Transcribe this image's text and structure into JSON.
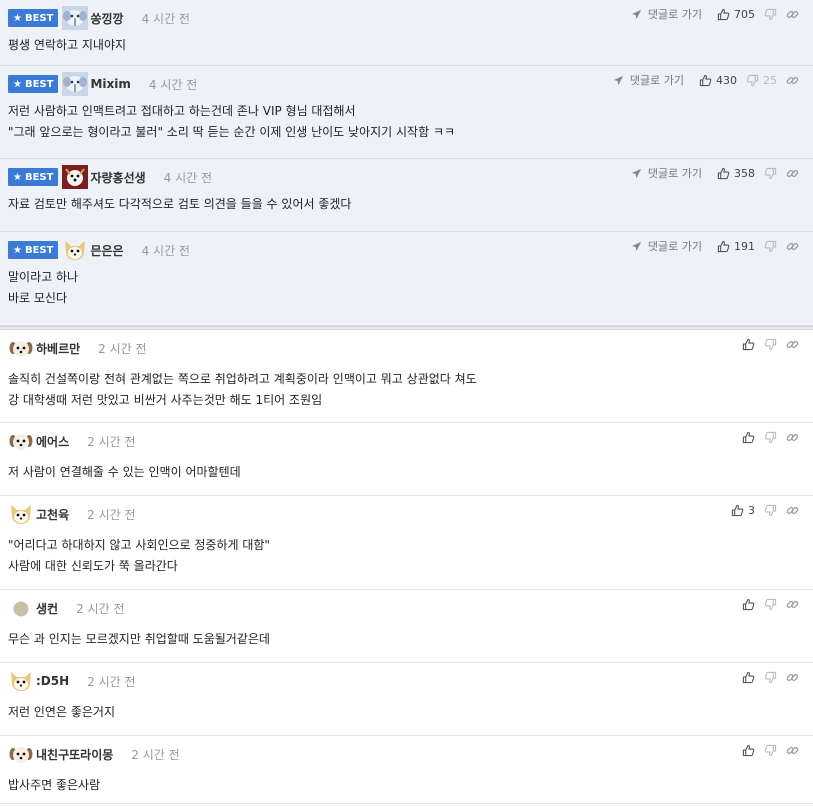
{
  "labels": {
    "best": "BEST",
    "reply": "댓글로 가기"
  },
  "colors": {
    "best_badge": "#3a7bd5",
    "best_bg": "#eef1f8"
  },
  "best_comments": [
    {
      "nick": "쏭낑깡",
      "avatar": "elephant-avatar",
      "time": "4 시간 전",
      "lines": [
        "평생 연락하고 지내야지"
      ],
      "likes": "705",
      "dislikes": ""
    },
    {
      "nick": "Mixim",
      "avatar": "elephant-avatar",
      "time": "4 시간 전",
      "lines": [
        "저런 사람하고 인맥트려고 접대하고 하는건데 존나 VIP 형님 대접해서",
        "\"그래 앞으로는 형이라고 불러\" 소리 딱 듣는 순간 이제 인생 난이도 낮아지기 시작함 ㅋㅋ"
      ],
      "likes": "430",
      "dislikes": "25"
    },
    {
      "nick": "자량홍선생",
      "avatar": "dog-avatar",
      "time": "4 시간 전",
      "lines": [
        "자료 검토만 해주셔도 다각적으로 검토 의견을 들을 수 있어서 좋겠다"
      ],
      "likes": "358",
      "dislikes": ""
    },
    {
      "nick": "믄은은",
      "avatar": "cat-avatar",
      "time": "4 시간 전",
      "lines": [
        "말이라고 하나",
        "바로 모신다"
      ],
      "likes": "191",
      "dislikes": ""
    }
  ],
  "comments": [
    {
      "nick": "하베르만",
      "avatar": "puppy-avatar",
      "time": "2 시간 전",
      "lines": [
        "솔직히 건설쪽이랑 전혀 관계없는 쪽으로 취업하려고 계획중이라 인맥이고 뭐고 상관없다 쳐도",
        "강 대학생때 저런 맛있고 비싼거 사주는것만 해도 1티어 조원임"
      ],
      "likes": ""
    },
    {
      "nick": "에어스",
      "avatar": "puppy-avatar",
      "time": "2 시간 전",
      "lines": [
        "저 사람이 연결해줄 수 있는 인맥이 어마할텐데"
      ],
      "likes": ""
    },
    {
      "nick": "고천육",
      "avatar": "cat-avatar",
      "time": "2 시간 전",
      "lines": [
        "\"어리다고 하대하지 않고 사회인으로 정중하게 대함\"",
        "사람에 대한 신뢰도가 쭉 올라간다"
      ],
      "likes": "3"
    },
    {
      "nick": "생컨",
      "avatar": "circle-avatar",
      "time": "2 시간 전",
      "lines": [
        "무슨 과 인지는 모르겠지만 취업할때 도움될거같은데"
      ],
      "likes": ""
    },
    {
      "nick": ":D5H",
      "avatar": "cat-avatar",
      "time": "2 시간 전",
      "lines": [
        "저런 인연은 좋은거지"
      ],
      "likes": ""
    },
    {
      "nick": "내친구또라이몽",
      "avatar": "puppy-avatar",
      "time": "2 시간 전",
      "lines": [
        "밥사주면 좋은사람"
      ],
      "likes": ""
    }
  ]
}
